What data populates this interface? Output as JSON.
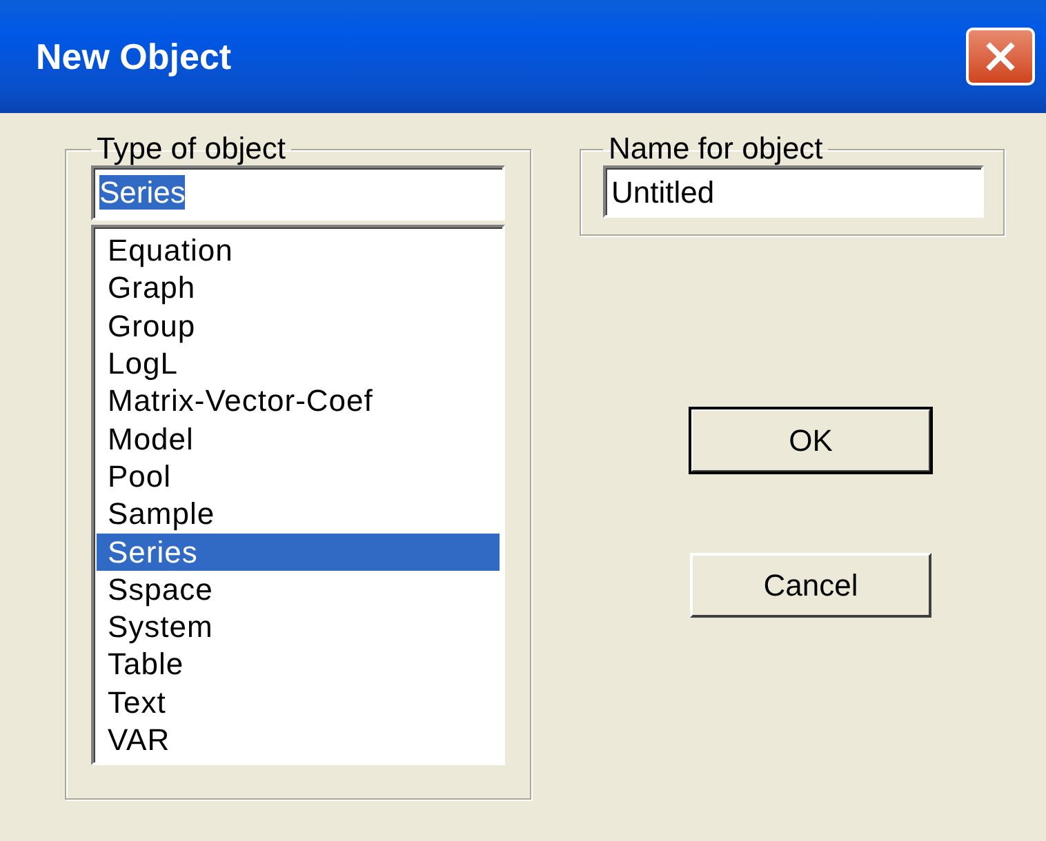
{
  "window": {
    "title": "New Object"
  },
  "type_group": {
    "legend": "Type of object",
    "field": {
      "value": "Series",
      "text_selected": true
    },
    "items": [
      {
        "label": "Equation",
        "selected": false
      },
      {
        "label": "Graph",
        "selected": false
      },
      {
        "label": "Group",
        "selected": false
      },
      {
        "label": "LogL",
        "selected": false
      },
      {
        "label": "Matrix-Vector-Coef",
        "selected": false
      },
      {
        "label": "Model",
        "selected": false
      },
      {
        "label": "Pool",
        "selected": false
      },
      {
        "label": "Sample",
        "selected": false
      },
      {
        "label": "Series",
        "selected": true
      },
      {
        "label": "Sspace",
        "selected": false
      },
      {
        "label": "System",
        "selected": false
      },
      {
        "label": "Table",
        "selected": false
      },
      {
        "label": "Text",
        "selected": false
      },
      {
        "label": "VAR",
        "selected": false
      }
    ]
  },
  "name_group": {
    "legend": "Name for object",
    "field": {
      "value": "Untitled"
    }
  },
  "buttons": [
    {
      "label": "OK",
      "default": true
    },
    {
      "label": "Cancel",
      "default": false
    }
  ]
}
